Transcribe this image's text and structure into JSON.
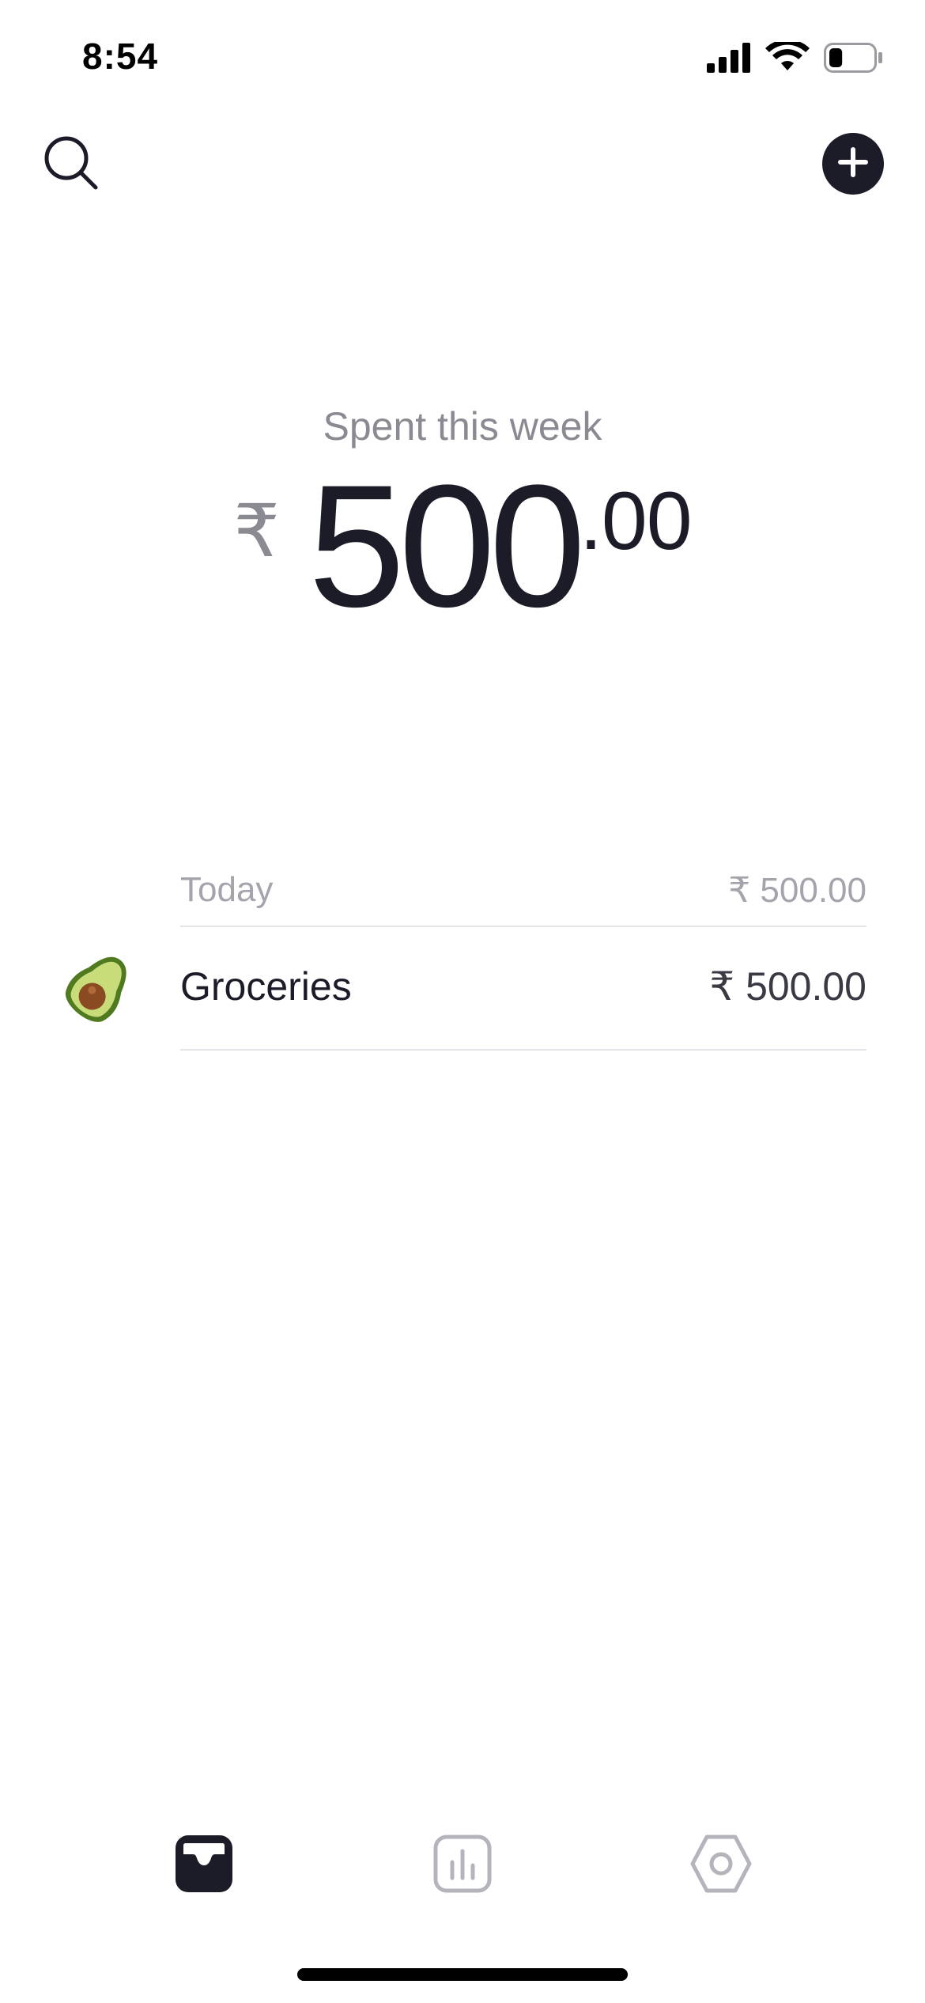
{
  "status_bar": {
    "time": "8:54",
    "icons": [
      "cellular-signal-icon",
      "wifi-icon",
      "battery-icon"
    ],
    "battery_level": 0.3
  },
  "top_bar": {
    "search_icon": "search-icon",
    "add_icon": "plus-icon"
  },
  "summary": {
    "label": "Spent this week",
    "currency": "₹",
    "amount_main": "500",
    "amount_decimal": ".00"
  },
  "transactions": {
    "day_label": "Today",
    "day_total": "₹ 500.00",
    "items": [
      {
        "icon": "avocado-icon",
        "name": "Groceries",
        "amount": "₹ 500.00"
      }
    ]
  },
  "tab_bar": {
    "tabs": [
      {
        "icon": "inbox-icon",
        "active": true
      },
      {
        "icon": "chart-icon",
        "active": false
      },
      {
        "icon": "settings-icon",
        "active": false
      }
    ]
  },
  "colors": {
    "text_primary": "#1c1c28",
    "text_secondary": "#8a8a93",
    "text_muted": "#a4a4ac",
    "divider": "#e3e3e8",
    "tab_inactive": "#b4b4bc",
    "avocado_skin": "#4f7a1f",
    "avocado_flesh": "#c9dc7a",
    "avocado_pit": "#8a4a22"
  }
}
